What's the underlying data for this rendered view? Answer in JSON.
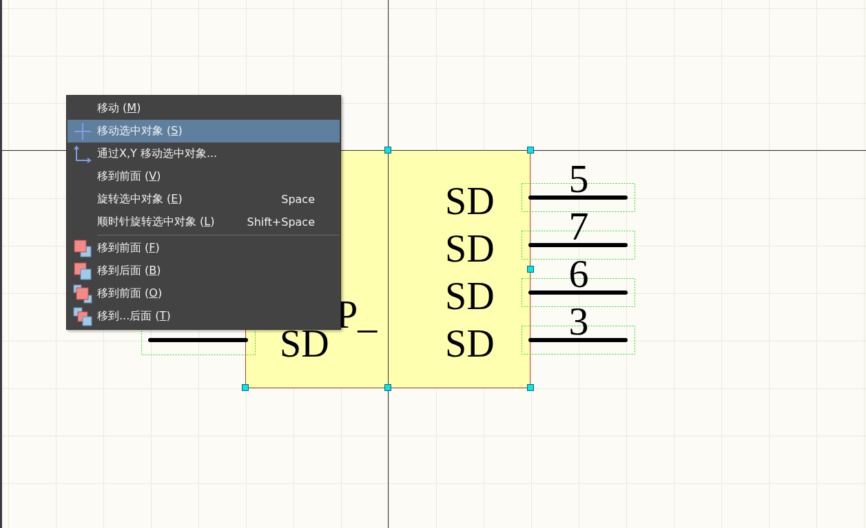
{
  "canvas": {
    "component": {
      "center_text": "P_",
      "left_pins": [
        {
          "label": "SD"
        }
      ],
      "right_pins": [
        {
          "number": "5",
          "label": "SD"
        },
        {
          "number": "7",
          "label": "SD"
        },
        {
          "number": "6",
          "label": "SD"
        },
        {
          "number": "3",
          "label": "SD"
        }
      ]
    }
  },
  "context_menu": {
    "items": [
      {
        "kind": "plain",
        "before": "移动 (",
        "mnemonic": "M",
        "after": ")",
        "selected": false
      },
      {
        "kind": "move",
        "before": "移动选中对象 (",
        "mnemonic": "S",
        "after": ")",
        "selected": true
      },
      {
        "kind": "move-xy",
        "before": "通过X,Y 移动选中对象...",
        "selected": false
      },
      {
        "kind": "plain",
        "before": "移到前面 (",
        "mnemonic": "V",
        "after": ")",
        "selected": false
      },
      {
        "kind": "plain",
        "before": "旋转选中对象 (",
        "mnemonic": "E",
        "after": ")",
        "shortcut": "Space",
        "selected": false
      },
      {
        "kind": "plain",
        "before": "顺时针旋转选中对象 (",
        "mnemonic": "L",
        "after": ")",
        "shortcut": "Shift+Space",
        "selected": false
      },
      {
        "kind": "separator"
      },
      {
        "kind": "bring-front",
        "before": "移到前面 (",
        "mnemonic": "F",
        "after": ")",
        "selected": false
      },
      {
        "kind": "send-back",
        "before": "移到后面 (",
        "mnemonic": "B",
        "after": ")",
        "selected": false
      },
      {
        "kind": "forward",
        "before": "移到前面 (",
        "mnemonic": "O",
        "after": ")",
        "selected": false
      },
      {
        "kind": "backward",
        "before": "移到...后面 (",
        "mnemonic": "T",
        "after": ")",
        "selected": false
      }
    ]
  }
}
